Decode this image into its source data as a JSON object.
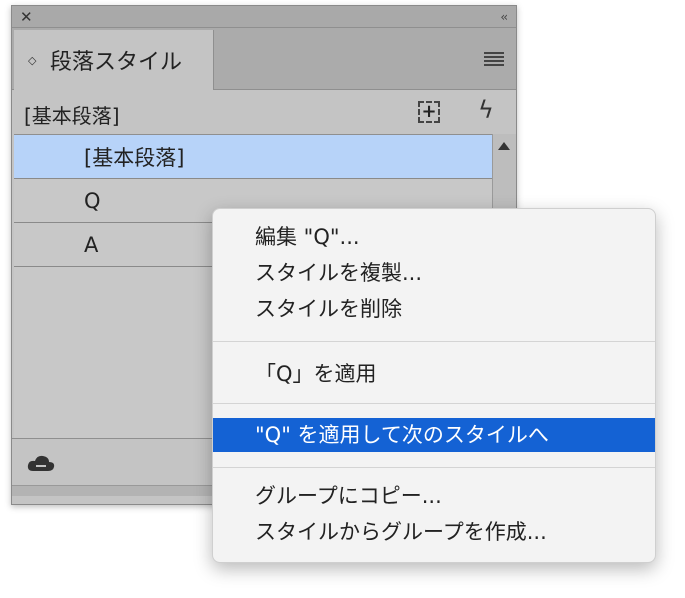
{
  "panel": {
    "tab_label": "段落スタイル",
    "current_style": "[基本段落]",
    "styles": [
      {
        "label": "[基本段落]",
        "selected": true
      },
      {
        "label": "Q",
        "selected": false
      },
      {
        "label": "A",
        "selected": false
      }
    ],
    "icons": {
      "close": "close-icon",
      "collapse": "collapse-double-chevron-icon",
      "tab_chevron": "up-down-chevron-icon",
      "menu": "hamburger-menu-icon",
      "new_style": "new-style-icon",
      "clear_overrides": "lightning-icon",
      "cloud": "creative-cloud-library-icon"
    },
    "selection_color": "#b7d3f9"
  },
  "context_menu": {
    "items": [
      {
        "label": "編集 \"Q\"...",
        "highlighted": false
      },
      {
        "label": "スタイルを複製...",
        "highlighted": false
      },
      {
        "label": "スタイルを削除",
        "highlighted": false
      },
      {
        "label": "「Q」を適用",
        "highlighted": false
      },
      {
        "label": "\"Q\" を適用して次のスタイルへ",
        "highlighted": true
      },
      {
        "label": "グループにコピー...",
        "highlighted": false
      },
      {
        "label": "スタイルからグループを作成...",
        "highlighted": false
      }
    ],
    "highlight_color": "#1462d4"
  }
}
